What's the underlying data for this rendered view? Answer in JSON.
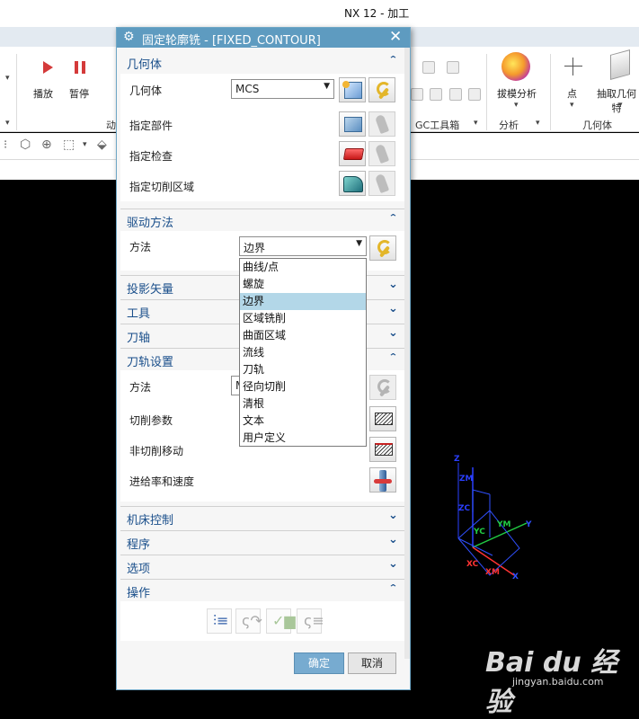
{
  "app": {
    "title": "NX 12 - 加工"
  },
  "ribbon": {
    "play_label": "播放",
    "pause_label": "暂停",
    "group_anim_label": "动",
    "group_gc_label": "GC工具箱",
    "draft_label": "拔模分析",
    "group_analysis_label": "分析",
    "point_label": "点",
    "extract_label": "抽取几何特",
    "group_geometry_label": "几何体"
  },
  "dialog": {
    "title": "固定轮廓铣 - [FIXED_CONTOUR]",
    "sections": {
      "geometry": {
        "header": "几何体",
        "geometry_label": "几何体",
        "geometry_value": "MCS",
        "part_label": "指定部件",
        "check_label": "指定检查",
        "cut_area_label": "指定切削区域"
      },
      "drive_method": {
        "header": "驱动方法",
        "method_label": "方法",
        "method_value": "边界",
        "options": [
          "曲线/点",
          "螺旋",
          "边界",
          "区域铣削",
          "曲面区域",
          "流线",
          "刀轨",
          "径向切削",
          "清根",
          "文本",
          "用户定义"
        ],
        "highlighted_option": "边界"
      },
      "projection_vector": {
        "header": "投影矢量"
      },
      "tool": {
        "header": "工具"
      },
      "tool_axis": {
        "header": "刀轴"
      },
      "path_settings": {
        "header": "刀轨设置",
        "method_label": "方法",
        "method_value_partial": "M",
        "cut_params_label": "切削参数",
        "non_cutting_label": "非切削移动",
        "feeds_speeds_label": "进给率和速度"
      },
      "machine_control": {
        "header": "机床控制"
      },
      "program": {
        "header": "程序"
      },
      "options": {
        "header": "选项"
      },
      "actions": {
        "header": "操作"
      }
    },
    "ok_label": "确定",
    "cancel_label": "取消"
  },
  "csys": {
    "labels": {
      "z": "Z",
      "zm": "ZM",
      "zc": "ZC",
      "ym": "YM",
      "yc": "YC",
      "y": "Y",
      "xc": "XC",
      "xm": "XM",
      "x": "X"
    },
    "colors": {
      "z": "#2a3fff",
      "y": "#22cc44",
      "x": "#ff3333",
      "wcs": "#3050ff"
    }
  },
  "watermark": {
    "brand": "Bai du 经验",
    "url": "jingyan.baidu.com"
  }
}
